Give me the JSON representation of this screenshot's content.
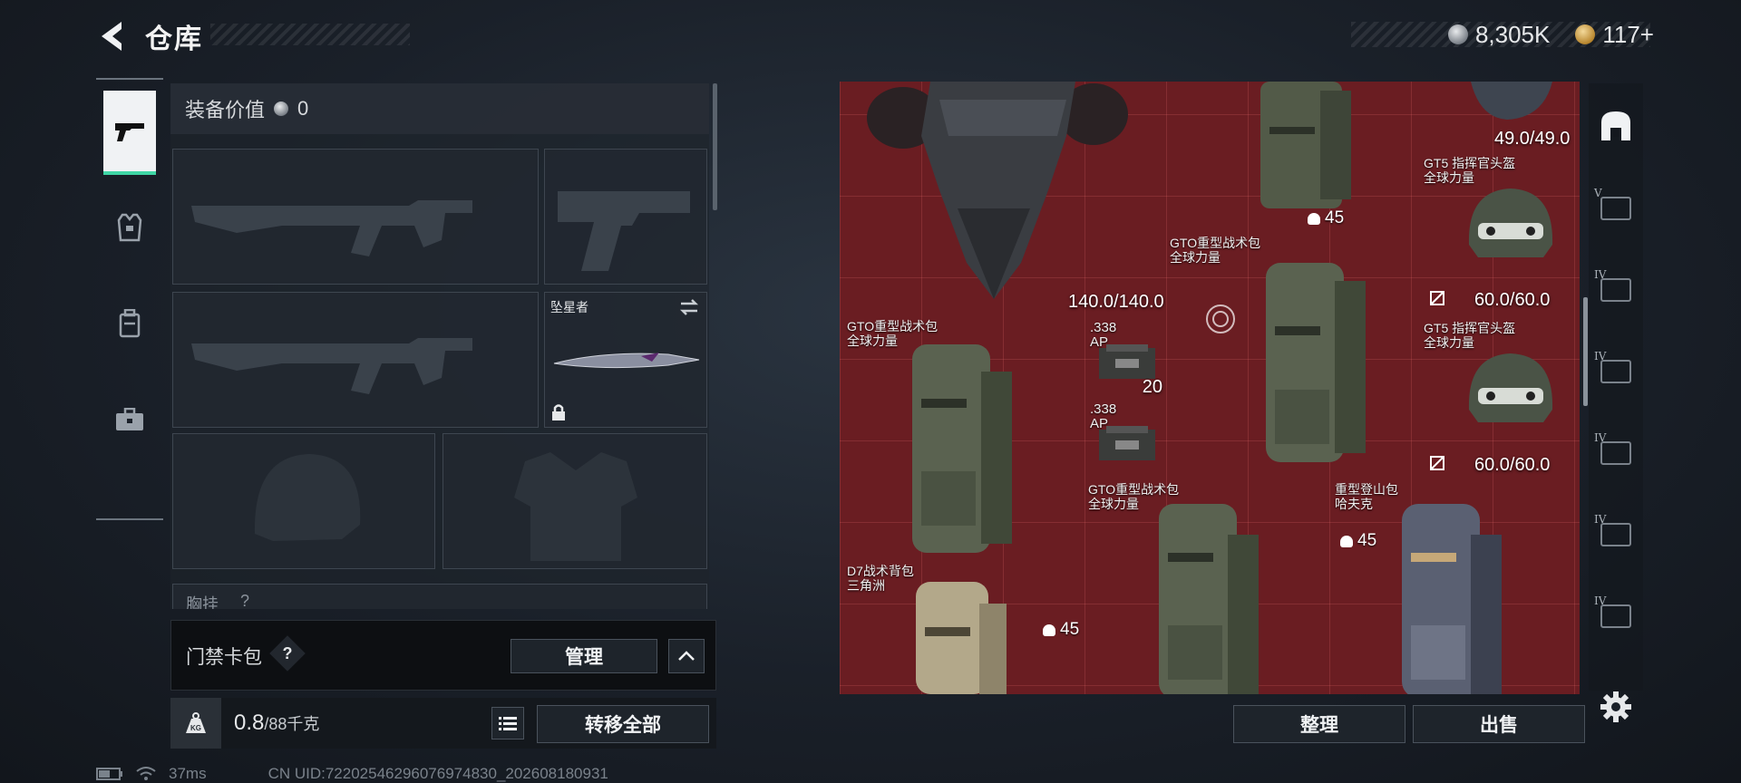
{
  "header": {
    "title": "仓库",
    "currency_silver": "8,305K",
    "currency_gold": "117+"
  },
  "left_tabs": [
    {
      "name": "weapons",
      "active": true
    },
    {
      "name": "armor",
      "active": false
    },
    {
      "name": "backpack",
      "active": false
    },
    {
      "name": "case",
      "active": false
    }
  ],
  "loadout": {
    "equip_value_label": "装备价值",
    "equip_value": "0",
    "melee_name": "坠星者",
    "chest_rig_label": "胸挂",
    "chest_rig_hint": "?"
  },
  "keycard": {
    "label": "门禁卡包",
    "help": "?",
    "manage": "管理",
    "collapse": "^"
  },
  "weight": {
    "current": "0.8",
    "max": "/88千克",
    "kg_icon": "KG",
    "transfer_all": "转移全部"
  },
  "status": {
    "ping": "37ms",
    "uid": "CN UID:72202546296076974830_202608180931"
  },
  "stash": {
    "items": [
      {
        "name": "",
        "durability": "140.0/140.0"
      },
      {
        "name": "",
        "capacity": "45"
      },
      {
        "name": "",
        "durability": "49.0/49.0"
      },
      {
        "name": "GT5 指挥官头盔\n全球力量",
        "durability": "60.0/60.0"
      },
      {
        "name": "GTO重型战术包\n全球力量",
        "capacity": "45"
      },
      {
        "name": "GTO重型战术包\n全球力量",
        "capacity": "45"
      },
      {
        "name": ".338\nAP",
        "count": "20"
      },
      {
        "name": ".338\nAP",
        "count": ""
      },
      {
        "name": "GT5 指挥官头盔\n全球力量",
        "durability": "60.0/60.0"
      },
      {
        "name": "GTO重型战术包\n全球力量",
        "capacity": ""
      },
      {
        "name": "重型登山包\n哈夫克",
        "capacity": ""
      },
      {
        "name": "D7战术背包\n三角洲",
        "capacity": ""
      }
    ],
    "sort_button": "整理",
    "sell_button": "出售"
  },
  "right_tabs": [
    {
      "name": "home",
      "roman": ""
    },
    {
      "name": "stash-5",
      "roman": "V"
    },
    {
      "name": "stash-4a",
      "roman": "IV"
    },
    {
      "name": "stash-4b",
      "roman": "IV"
    },
    {
      "name": "stash-4c",
      "roman": "IV"
    },
    {
      "name": "stash-4d",
      "roman": "IV"
    },
    {
      "name": "stash-4e",
      "roman": "IV"
    }
  ]
}
